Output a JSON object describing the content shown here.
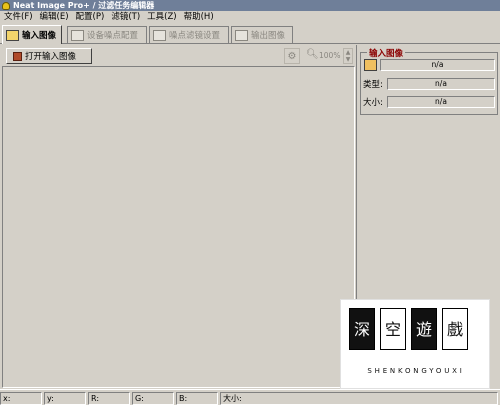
{
  "window": {
    "title": "Neat Image Pro+ / 过滤任务编辑器"
  },
  "menu": [
    "文件(F)",
    "编辑(E)",
    "配置(P)",
    "滤镜(T)",
    "工具(Z)",
    "帮助(H)"
  ],
  "tabs": [
    {
      "label": "输入图像",
      "state": "active",
      "icon": "image-input-icon"
    },
    {
      "label": "设备噪点配置",
      "state": "disabled",
      "icon": "device-noise-icon"
    },
    {
      "label": "噪点滤镜设置",
      "state": "disabled",
      "icon": "filter-settings-icon"
    },
    {
      "label": "输出图像",
      "state": "disabled",
      "icon": "output-image-icon"
    }
  ],
  "toolbar": {
    "open_label": "打开输入图像",
    "zoom": "100%"
  },
  "input_panel": {
    "title": "输入图像",
    "file_value": "n/a",
    "type_label": "类型:",
    "type_value": "n/a",
    "size_label": "大小:",
    "size_value": "n/a"
  },
  "status": [
    "x:",
    "y:",
    "R:",
    "G:",
    "B:",
    "大小:"
  ],
  "watermark": {
    "chars": [
      "深",
      "空",
      "遊",
      "戲"
    ],
    "text": "SHENKONGYOUXI"
  }
}
